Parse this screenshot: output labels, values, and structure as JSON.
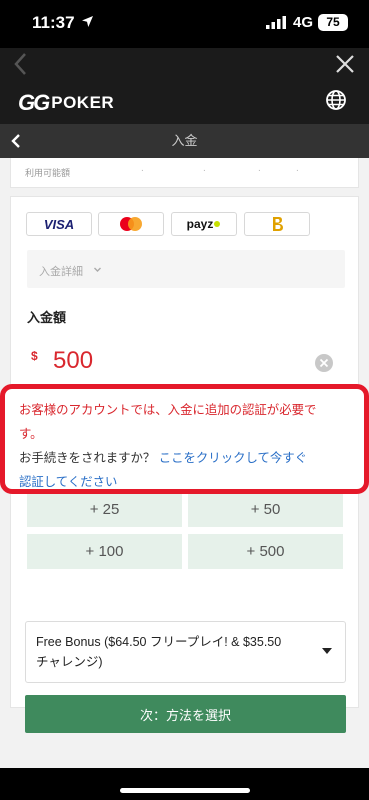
{
  "status_bar": {
    "time": "11:37",
    "network": "4G",
    "battery": "75"
  },
  "brand": {
    "gg": "GG",
    "poker": "POKER"
  },
  "page": {
    "title": "入金"
  },
  "balance": {
    "label": "利用可能額",
    "dots": [
      ".",
      ".",
      ".",
      "."
    ]
  },
  "payment_methods": [
    {
      "name": "VISA",
      "icon": "visa-logo"
    },
    {
      "name": "Mastercard",
      "icon": "mastercard-logo"
    },
    {
      "name": "payz",
      "icon": "payz-logo"
    },
    {
      "name": "Bitcoin",
      "icon": "bitcoin-logo"
    }
  ],
  "details": {
    "label": "入金詳細"
  },
  "amount": {
    "heading": "入金額",
    "currency": "$",
    "value": "500"
  },
  "alert": {
    "line1": "お客様のアカウントでは、入金に追加の認証が必要で",
    "line2": "す。",
    "line3_prefix": "お手続きをされますか？ ",
    "line3_link": "ここをクリックして今すぐ",
    "line4_link": "認証してください"
  },
  "quick_amounts": [
    "+ 25",
    "+ 50",
    "+ 100",
    "+ 500"
  ],
  "bonus": {
    "line1": "Free Bonus ($64.50 フリープレイ! & $35.50",
    "line2": "チャレンジ)"
  },
  "next_button": "次：方法を選択",
  "colors": {
    "accent_green": "#3f8a5d",
    "alert_red": "#e5192a",
    "link_blue": "#2a6fc7"
  }
}
